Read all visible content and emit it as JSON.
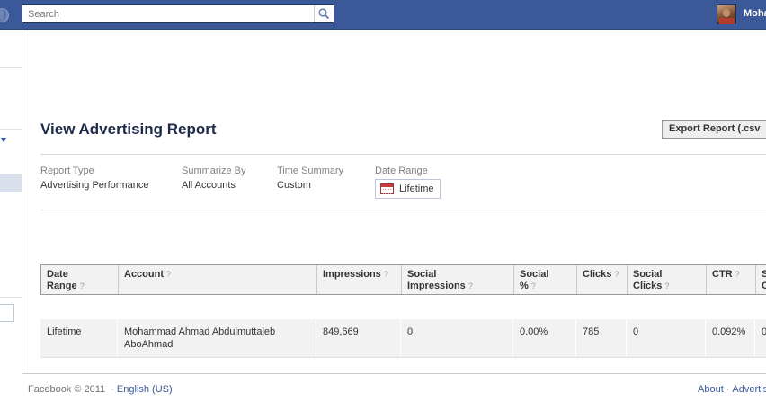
{
  "header": {
    "search_placeholder": "Search",
    "username": "Moha"
  },
  "report": {
    "title": "View Advertising Report",
    "export_label": "Export Report (.csv",
    "summary": [
      {
        "label": "Report Type",
        "value": "Advertising Performance"
      },
      {
        "label": "Summarize By",
        "value": "All Accounts"
      },
      {
        "label": "Time Summary",
        "value": "Custom"
      },
      {
        "label": "Date Range",
        "value": "Lifetime"
      }
    ]
  },
  "table": {
    "help_mark": "?",
    "columns": [
      {
        "line1": "Date",
        "line2": "Range",
        "help": true
      },
      {
        "line1": "Account",
        "line2": "",
        "help": true
      },
      {
        "line1": "Impressions",
        "line2": "",
        "help": true
      },
      {
        "line1": "Social",
        "line2": "Impressions",
        "help": true
      },
      {
        "line1": "Social",
        "line2": "%",
        "help": true
      },
      {
        "line1": "Clicks",
        "line2": "",
        "help": true
      },
      {
        "line1": "Social",
        "line2": "Clicks",
        "help": true
      },
      {
        "line1": "CTR",
        "line2": "",
        "help": true
      },
      {
        "line1": "S",
        "line2": "C",
        "help": false
      }
    ],
    "rows": [
      {
        "date_range": "Lifetime",
        "account_line1": "Mohammad Ahmad Abdulmuttaleb",
        "account_line2": "AboAhmad",
        "impressions": "849,669",
        "social_impressions": "0",
        "social_percent": "0.00%",
        "clicks": "785",
        "social_clicks": "0",
        "ctr": "0.092%",
        "cut_col": "0"
      }
    ]
  },
  "footer": {
    "copyright": "Facebook © 2011",
    "separator": "·",
    "language": "English (US)",
    "about": "About",
    "advertising": "Advertis"
  },
  "colors": {
    "brand_blue": "#3b5998",
    "title_navy": "#1c2a47",
    "header_gray": "#f2f2f2"
  },
  "icons": [
    "globe-icon",
    "search-icon",
    "calendar-icon",
    "question-icon"
  ]
}
